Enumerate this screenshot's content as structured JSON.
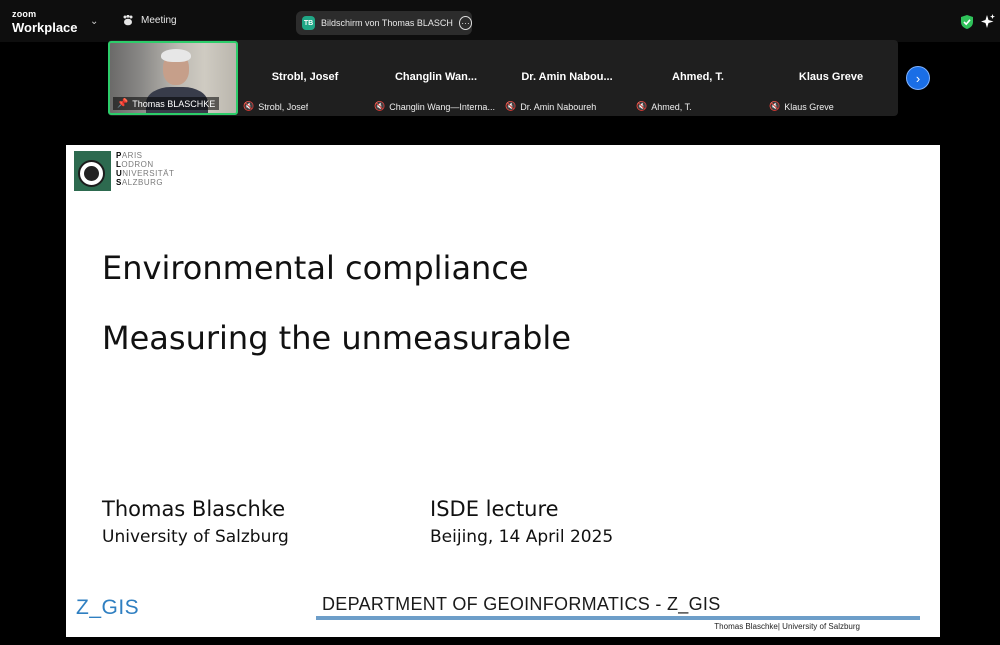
{
  "app": {
    "logo_small": "zoom",
    "logo_big": "Workplace",
    "meeting_label": "Meeting",
    "share": {
      "avatar_initials": "TB",
      "text": "Bildschirm von Thomas BLASCH"
    }
  },
  "participants": {
    "active": {
      "name": "Thomas BLASCHKE"
    },
    "tiles": [
      {
        "display_name": "Strobl, Josef",
        "label": "Strobl, Josef"
      },
      {
        "display_name": "Changlin Wan...",
        "label": "Changlin Wang—Interna..."
      },
      {
        "display_name": "Dr. Amin Nabou...",
        "label": "Dr. Amin Naboureh"
      },
      {
        "display_name": "Ahmed, T.",
        "label": "Ahmed, T."
      },
      {
        "display_name": "Klaus Greve",
        "label": "Klaus Greve"
      }
    ]
  },
  "slide": {
    "university_lines": [
      "PARIS",
      "LODRON",
      "UNIVERSITÄT",
      "SALZBURG"
    ],
    "title_line1": "Environmental compliance",
    "title_line2": "Measuring the unmeasurable",
    "author_name": "Thomas Blaschke",
    "author_affiliation": "University of Salzburg",
    "event_name": "ISDE lecture",
    "event_date": "Beijing, 14 April 2025",
    "zgis_logo": "Z_GIS",
    "department": "DEPARTMENT OF GEOINFORMATICS - Z_GIS",
    "footer": "Thomas Blaschke| University of Salzburg"
  },
  "colors": {
    "active_border": "#2ccd6a",
    "next_button": "#1a6ee6",
    "muted_mic": "#e04a4a",
    "plus_green": "#2d6a4f",
    "zgis_blue": "#2f7fc1"
  },
  "icons": [
    "chevron-down-icon",
    "paw-icon",
    "more-icon",
    "shield-check-icon",
    "sparkle-icon",
    "pin-icon",
    "mic-off-icon",
    "chevron-right-icon"
  ]
}
